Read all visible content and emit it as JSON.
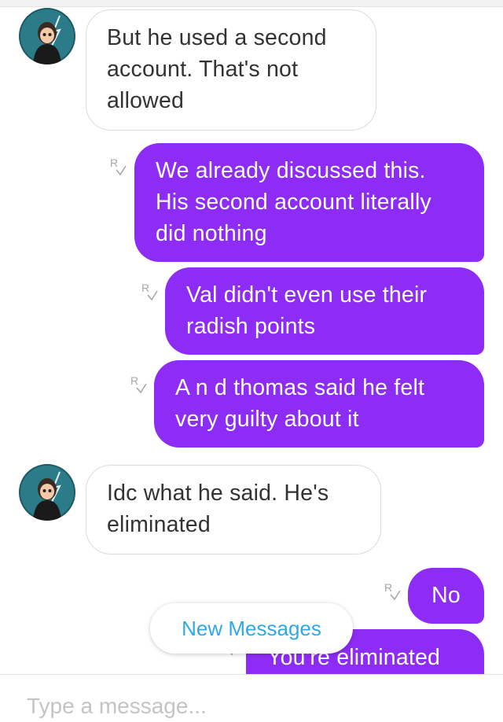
{
  "messages": [
    {
      "sender": "them",
      "text": "But he used a second account. That's not allowed"
    },
    {
      "sender": "me",
      "text": "We already discussed this. His second account literally did nothing",
      "receipt": "R"
    },
    {
      "sender": "me",
      "text": "Val didn't even use their radish points",
      "receipt": "R"
    },
    {
      "sender": "me",
      "text": "A n d thomas said he felt very guilty about it",
      "receipt": "R"
    },
    {
      "sender": "them",
      "text": "Idc what he said. He's eliminated"
    },
    {
      "sender": "me",
      "text": "No",
      "receipt": "R"
    },
    {
      "sender": "me",
      "text": "You're eliminated"
    }
  ],
  "new_messages_pill": "New Messages",
  "composer": {
    "placeholder": "Type a message..."
  },
  "colors": {
    "outgoing_bubble": "#8d2cf5",
    "accent": "#2fa9e5"
  },
  "icons": {
    "avatar": "avatar-icon",
    "read_receipt": "read-receipt-icon"
  }
}
